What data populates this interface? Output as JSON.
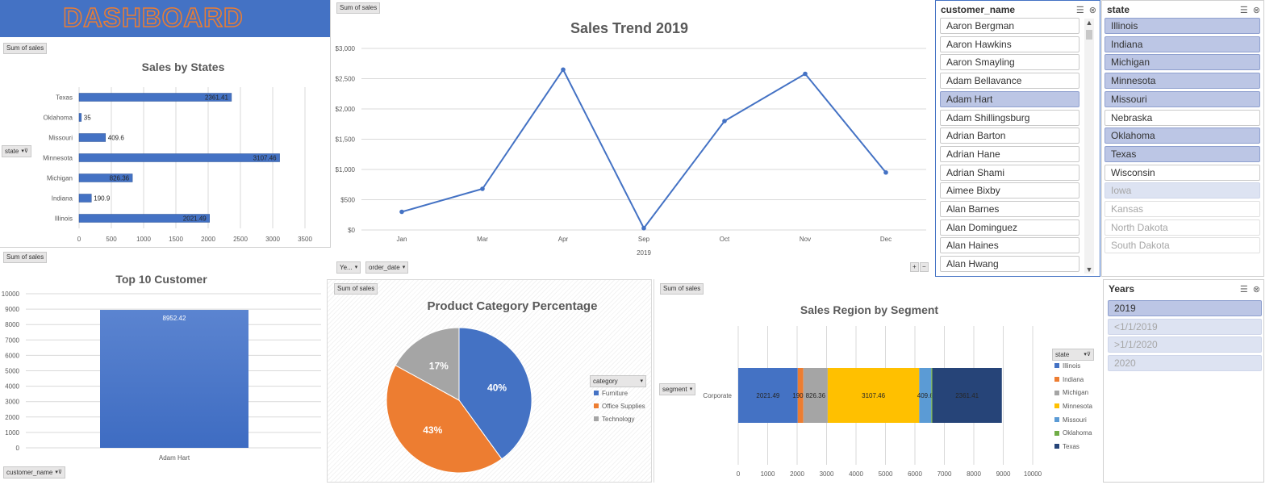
{
  "dashboard_title": "DASHBOARD",
  "colors": {
    "title_bg": "#4472c4",
    "title_text": "#ed7d31",
    "bar_blue": "#4472c4",
    "orange": "#ed7d31",
    "gray": "#a5a5a5",
    "yellow": "#ffc000",
    "light_blue": "#5b9bd5",
    "green": "#70ad47",
    "navy": "#264478",
    "slicer_selected": "#bcc6e5"
  },
  "sales_by_states": {
    "field_button": "Sum of sales",
    "row_field": "state",
    "chart_data": {
      "type": "bar",
      "title": "Sales by States",
      "categories": [
        "Texas",
        "Oklahoma",
        "Missouri",
        "Minnesota",
        "Michigan",
        "Indiana",
        "Illinois"
      ],
      "values": [
        2361.41,
        35,
        409.6,
        3107.46,
        826.36,
        190.9,
        2021.49
      ],
      "data_labels": [
        "2361.41",
        "35",
        "409.6",
        "3107.46",
        "826.36",
        "190.9",
        "2021.49"
      ],
      "xlim": [
        0,
        3500
      ],
      "xticks": [
        "0",
        "500",
        "1000",
        "1500",
        "2000",
        "2500",
        "3000",
        "3500"
      ],
      "grid": true
    }
  },
  "sales_trend": {
    "field_button": "Sum of sales",
    "field_buttons_bottom": [
      "Ye...",
      "order_date"
    ],
    "expand_buttons": [
      "+",
      "−"
    ],
    "chart_data": {
      "type": "line",
      "title": "Sales Trend 2019",
      "categories": [
        "Jan",
        "Mar",
        "Apr",
        "Sep",
        "Oct",
        "Nov",
        "Dec"
      ],
      "values": [
        300,
        680,
        2650,
        30,
        1800,
        2580,
        950
      ],
      "xlabel": "2019",
      "ylim": [
        0,
        3000
      ],
      "yticks": [
        "$0",
        "$500",
        "$1,000",
        "$1,500",
        "$2,000",
        "$2,500",
        "$3,000"
      ],
      "grid": true
    }
  },
  "top_customers": {
    "field_button": "Sum of sales",
    "row_field": "customer_name",
    "chart_data": {
      "type": "bar",
      "title": "Top 10 Customer",
      "categories": [
        "Adam Hart"
      ],
      "values": [
        8952.42
      ],
      "data_labels": [
        "8952.42"
      ],
      "ylim": [
        0,
        10000
      ],
      "yticks": [
        "0",
        "1000",
        "2000",
        "3000",
        "4000",
        "5000",
        "6000",
        "7000",
        "8000",
        "9000",
        "10000"
      ],
      "grid": true
    }
  },
  "product_category": {
    "field_button": "Sum of sales",
    "legend_field": "category",
    "chart_data": {
      "type": "pie",
      "title": "Product Category Percentage",
      "categories": [
        "Furniture",
        "Office Supplies",
        "Technology"
      ],
      "values": [
        40,
        43,
        17
      ],
      "data_labels": [
        "40%",
        "43%",
        "17%"
      ],
      "legend": "right"
    }
  },
  "region_segment": {
    "field_button": "Sum of sales",
    "row_field": "segment",
    "legend_field": "state",
    "chart_data": {
      "type": "bar",
      "title": "Sales Region by Segment",
      "categories": [
        "Corporate"
      ],
      "series": [
        {
          "name": "Illinois",
          "values": [
            2021.49
          ],
          "label": "2021.49"
        },
        {
          "name": "Indiana",
          "values": [
            190.9
          ],
          "label": "190.9"
        },
        {
          "name": "Michigan",
          "values": [
            826.36
          ],
          "label": "826.36"
        },
        {
          "name": "Minnesota",
          "values": [
            3107.46
          ],
          "label": "3107.46"
        },
        {
          "name": "Missouri",
          "values": [
            409.6
          ],
          "label": "409.6"
        },
        {
          "name": "Oklahoma",
          "values": [
            35
          ],
          "label": ""
        },
        {
          "name": "Texas",
          "values": [
            2361.41
          ],
          "label": "2361.41"
        }
      ],
      "xlim": [
        0,
        10000
      ],
      "xticks": [
        "0",
        "1000",
        "2000",
        "3000",
        "4000",
        "5000",
        "6000",
        "7000",
        "8000",
        "9000",
        "10000"
      ],
      "legend": "right",
      "grid": true
    }
  },
  "slicer_customer": {
    "title": "customer_name",
    "items": [
      {
        "label": "Aaron Bergman",
        "state": "normal"
      },
      {
        "label": "Aaron Hawkins",
        "state": "normal"
      },
      {
        "label": "Aaron Smayling",
        "state": "normal"
      },
      {
        "label": "Adam Bellavance",
        "state": "normal"
      },
      {
        "label": "Adam Hart",
        "state": "selected"
      },
      {
        "label": "Adam Shillingsburg",
        "state": "normal"
      },
      {
        "label": "Adrian Barton",
        "state": "normal"
      },
      {
        "label": "Adrian Hane",
        "state": "normal"
      },
      {
        "label": "Adrian Shami",
        "state": "normal"
      },
      {
        "label": "Aimee Bixby",
        "state": "normal"
      },
      {
        "label": "Alan Barnes",
        "state": "normal"
      },
      {
        "label": "Alan Dominguez",
        "state": "normal"
      },
      {
        "label": "Alan Haines",
        "state": "normal"
      },
      {
        "label": "Alan Hwang",
        "state": "normal"
      }
    ]
  },
  "slicer_state": {
    "title": "state",
    "items": [
      {
        "label": "Illinois",
        "state": "selected"
      },
      {
        "label": "Indiana",
        "state": "selected"
      },
      {
        "label": "Michigan",
        "state": "selected"
      },
      {
        "label": "Minnesota",
        "state": "selected"
      },
      {
        "label": "Missouri",
        "state": "selected"
      },
      {
        "label": "Nebraska",
        "state": "normal"
      },
      {
        "label": "Oklahoma",
        "state": "selected"
      },
      {
        "label": "Texas",
        "state": "selected"
      },
      {
        "label": "Wisconsin",
        "state": "normal"
      },
      {
        "label": "Iowa",
        "state": "nodata-sel"
      },
      {
        "label": "Kansas",
        "state": "nodata"
      },
      {
        "label": "North Dakota",
        "state": "nodata"
      },
      {
        "label": "South Dakota",
        "state": "nodata"
      }
    ]
  },
  "slicer_years": {
    "title": "Years",
    "items": [
      {
        "label": "2019",
        "state": "selected"
      },
      {
        "label": "<1/1/2019",
        "state": "nodata-sel"
      },
      {
        "label": ">1/1/2020",
        "state": "nodata-sel"
      },
      {
        "label": "2020",
        "state": "nodata-sel"
      }
    ]
  }
}
